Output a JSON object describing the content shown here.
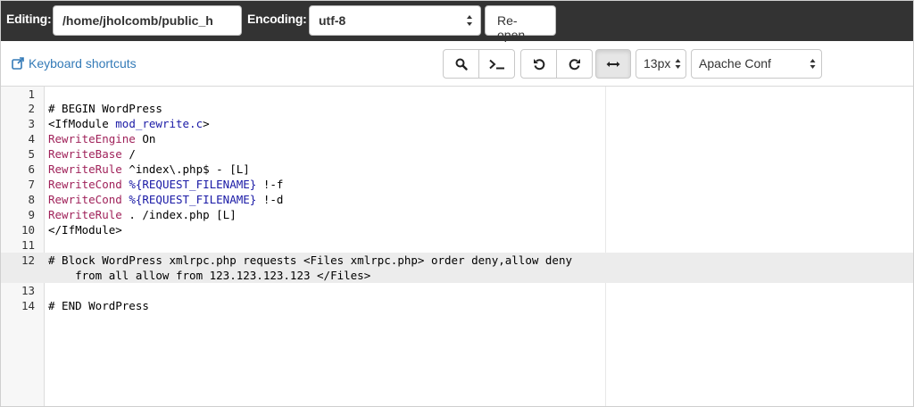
{
  "header": {
    "editing_label": "Editing:",
    "path_value": "/home/jholcomb/public_h",
    "encoding_label": "Encoding:",
    "encoding_value": "utf-8",
    "reopen_label": "Re-open"
  },
  "toolbar": {
    "keyboard_shortcuts": "Keyboard shortcuts",
    "font_size": "13px",
    "mode": "Apache Conf",
    "icons": [
      "search-icon",
      "terminal-icon",
      "undo-icon",
      "redo-icon",
      "wrap-toggle-icon"
    ]
  },
  "editor": {
    "line_numbers": [
      "1",
      "2",
      "3",
      "4",
      "5",
      "6",
      "7",
      "8",
      "9",
      "10",
      "11",
      "12",
      "",
      "13",
      "14"
    ],
    "lines": {
      "l2": "# BEGIN WordPress",
      "l3a": "<IfModule ",
      "l3b": "mod_rewrite.c",
      "l3c": ">",
      "l4a": "RewriteEngine",
      "l4b": " On",
      "l5a": "RewriteBase",
      "l5b": " /",
      "l6a": "RewriteRule",
      "l6b": " ^index\\.php$ - [L]",
      "l7a": "RewriteCond",
      "l7b": " %{REQUEST_FILENAME}",
      "l7c": " !-f",
      "l8a": "RewriteCond",
      "l8b": " %{REQUEST_FILENAME}",
      "l8c": " !-d",
      "l9a": "RewriteRule",
      "l9b": " . /index.php [L]",
      "l10": "</IfModule>",
      "l12": "# Block WordPress xmlrpc.php requests <Files xmlrpc.php> order deny,allow deny",
      "l12w": "    from all allow from 123.123.123.123 </Files>",
      "l14": "# END WordPress"
    }
  },
  "colors": {
    "topbar": "#333333",
    "link": "#337ab7",
    "comment": "#1f4fa0",
    "keyword": "#a0225a",
    "variable": "#1a1aa6"
  }
}
